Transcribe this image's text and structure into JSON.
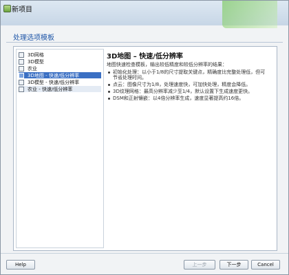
{
  "window": {
    "title": "新项目"
  },
  "dialog": {
    "title": "处理选项模板"
  },
  "options": [
    {
      "label": "3D网格",
      "state": "normal"
    },
    {
      "label": "3D模型",
      "state": "normal"
    },
    {
      "label": "农业",
      "state": "normal"
    },
    {
      "label": "3D地图 - 快速/低分辨率",
      "state": "selected"
    },
    {
      "label": "3D模型 - 快速/低分辨率",
      "state": "normal"
    },
    {
      "label": "农业 - 快速/低分辨率",
      "state": "hover"
    }
  ],
  "description": {
    "title": "3D地图 – 快速/低分辨率",
    "intro": "地图快速检查模板，输出较低精度和较低分辨率的结果：",
    "bullets": [
      "初始化处理：以小于1/8的尺寸提取关键点，精确度比完整处理低，但可节省处理时间。",
      "点云：图像尺寸为1/8，处理速度快，可加快处理，精度会降低。",
      "3D纹理网格：最高分辨率减少至1/4，默认设置下生成速度更快。",
      "DSM和正射镶嵌：以4倍分辨率生成，速度显著提高约16倍。"
    ]
  },
  "buttons": {
    "help": "Help",
    "back": "上一步",
    "next": "下一步",
    "cancel": "Cancel"
  }
}
